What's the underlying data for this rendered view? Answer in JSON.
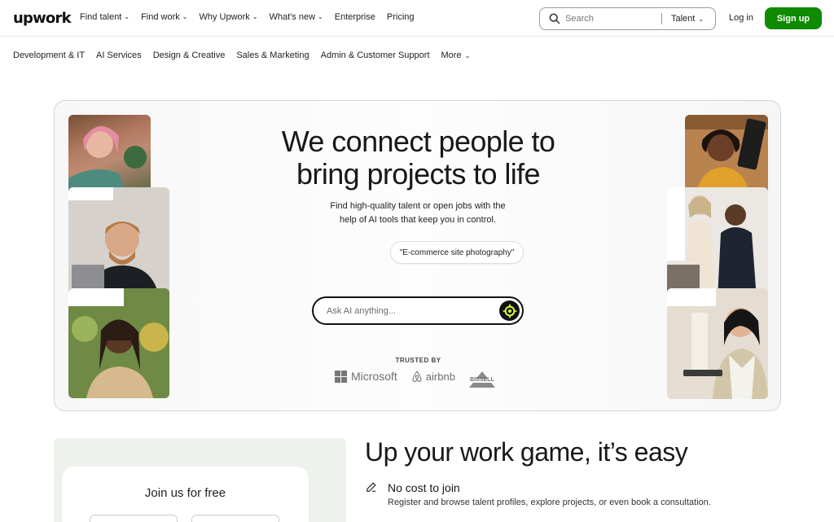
{
  "header": {
    "logo": "upwork",
    "nav": [
      {
        "label": "Find talent"
      },
      {
        "label": "Find work"
      },
      {
        "label": "Why Upwork"
      },
      {
        "label": "What's new"
      },
      {
        "label": "Enterprise"
      },
      {
        "label": "Pricing"
      }
    ],
    "search": {
      "placeholder": "Search",
      "scope": "Talent"
    },
    "login": "Log in",
    "signup": "Sign up"
  },
  "categories": [
    "Development & IT",
    "AI Services",
    "Design & Creative",
    "Sales & Marketing",
    "Admin & Customer Support",
    "More"
  ],
  "hero": {
    "title_line1": "We connect people to",
    "title_line2": "bring projects to life",
    "subtitle_line1": "Find high-quality talent or open jobs with the",
    "subtitle_line2": "help of AI tools that keep you in control.",
    "suggestion": "\"E-commerce site photography\"",
    "ask_placeholder": "Ask AI anything...",
    "trusted_by": "TRUSTED BY",
    "logos": {
      "microsoft": "Microsoft",
      "airbnb": "airbnb",
      "bissell": "BISSELL"
    }
  },
  "join": {
    "title": "Join us for free"
  },
  "section": {
    "heading": "Up your work game, it’s easy",
    "feature_title": "No cost to join",
    "feature_desc": "Register and browse talent profiles, explore projects, or even book a consultation."
  },
  "colors": {
    "brand_green": "#108a00",
    "text": "#181818",
    "join_bg": "#eef2ec"
  }
}
